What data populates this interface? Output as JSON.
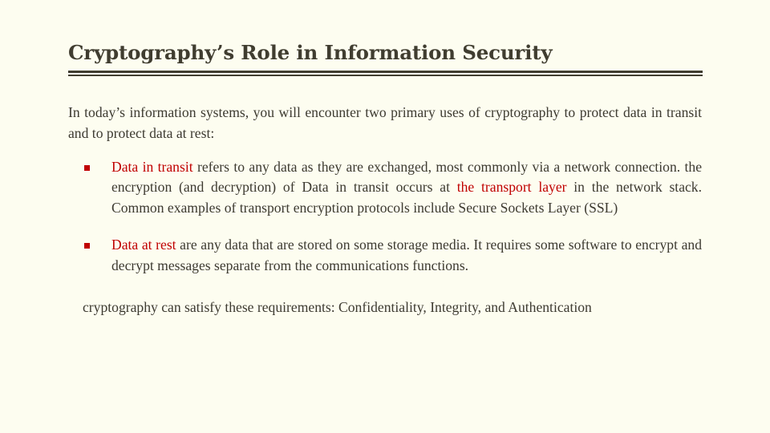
{
  "slide": {
    "title": "Cryptography’s Role in Information Security",
    "background_color": "#fdfdf0",
    "title_color": "#403d30",
    "body_color": "#3d3a31",
    "accent_color": "#c00000",
    "rule_color": "#403d30"
  },
  "intro": {
    "text": "In today’s information systems, you will encounter two primary uses of cryptography to protect data in transit and to protect data at rest:"
  },
  "bullets": [
    {
      "marker": "square-bullet-icon",
      "lead": "Data in transit",
      "lead_color": "#c00000",
      "rest_a": " refers to any data as they are exchanged, most commonly via a network connection. the encryption (and decryption) of Data in transit occurs at ",
      "emphasis": "the transport layer",
      "emphasis_color": "#c00000",
      "rest_b": " in the network stack. Common examples of transport encryption protocols include Secure Sockets Layer (SSL)"
    },
    {
      "marker": "square-bullet-icon",
      "lead": "Data at rest",
      "lead_color": "#c00000",
      "rest_a": " are any data that are stored on some storage media. It requires some software to encrypt and decrypt messages separate from the communications functions.",
      "emphasis": "",
      "emphasis_color": "#c00000",
      "rest_b": ""
    }
  ],
  "closing": {
    "text": "cryptography can satisfy these requirements: Confidentiality, Integrity, and Authentication"
  }
}
